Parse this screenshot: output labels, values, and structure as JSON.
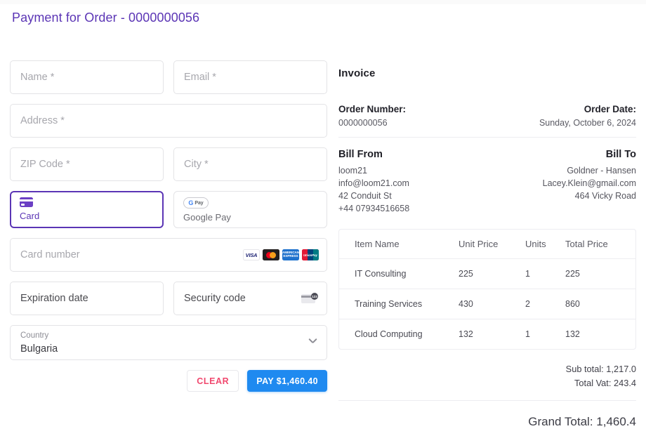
{
  "header": {
    "title": "Payment for Order - 0000000056"
  },
  "form": {
    "fields": {
      "name": "Name *",
      "email": "Email *",
      "address": "Address *",
      "zip": "ZIP Code *",
      "city": "City *",
      "card_number": "Card number",
      "expiration": "Expiration date",
      "security_code": "Security code"
    },
    "payment_methods": [
      {
        "id": "card",
        "label": "Card",
        "icon": "credit-card-icon",
        "active": true
      },
      {
        "id": "google-pay",
        "label": "Google Pay",
        "icon": "google-pay-icon",
        "active": false
      }
    ],
    "card_brands": [
      "visa",
      "mastercard",
      "amex",
      "unionpay"
    ],
    "country": {
      "label": "Country",
      "value": "Bulgaria"
    },
    "buttons": {
      "clear": "CLEAR",
      "pay": "PAY $1,460.40"
    }
  },
  "invoice": {
    "title": "Invoice",
    "order_number_label": "Order Number:",
    "order_number": "0000000056",
    "order_date_label": "Order Date:",
    "order_date": "Sunday, October 6, 2024",
    "bill_from": {
      "heading": "Bill From",
      "lines": [
        "loom21",
        "info@loom21.com",
        "42 Conduit St",
        "+44 07934516658"
      ]
    },
    "bill_to": {
      "heading": "Bill To",
      "lines": [
        "Goldner - Hansen",
        "Lacey.Klein@gmail.com",
        "464 Vicky Road"
      ]
    },
    "table": {
      "columns": [
        "Item Name",
        "Unit Price",
        "Units",
        "Total Price"
      ],
      "rows": [
        [
          "IT Consulting",
          "225",
          "1",
          "225"
        ],
        [
          "Training Services",
          "430",
          "2",
          "860"
        ],
        [
          "Cloud Computing",
          "132",
          "1",
          "132"
        ]
      ]
    },
    "totals": {
      "sub_total": "Sub total: 1,217.0",
      "total_vat": "Total Vat: 243.4",
      "grand_total": "Grand Total: 1,460.4"
    }
  },
  "colors": {
    "title_purple": "#5b35b5",
    "pay_blue": "#1f8af0",
    "clear_red": "#f0486e",
    "border": "#e3e3e6"
  }
}
